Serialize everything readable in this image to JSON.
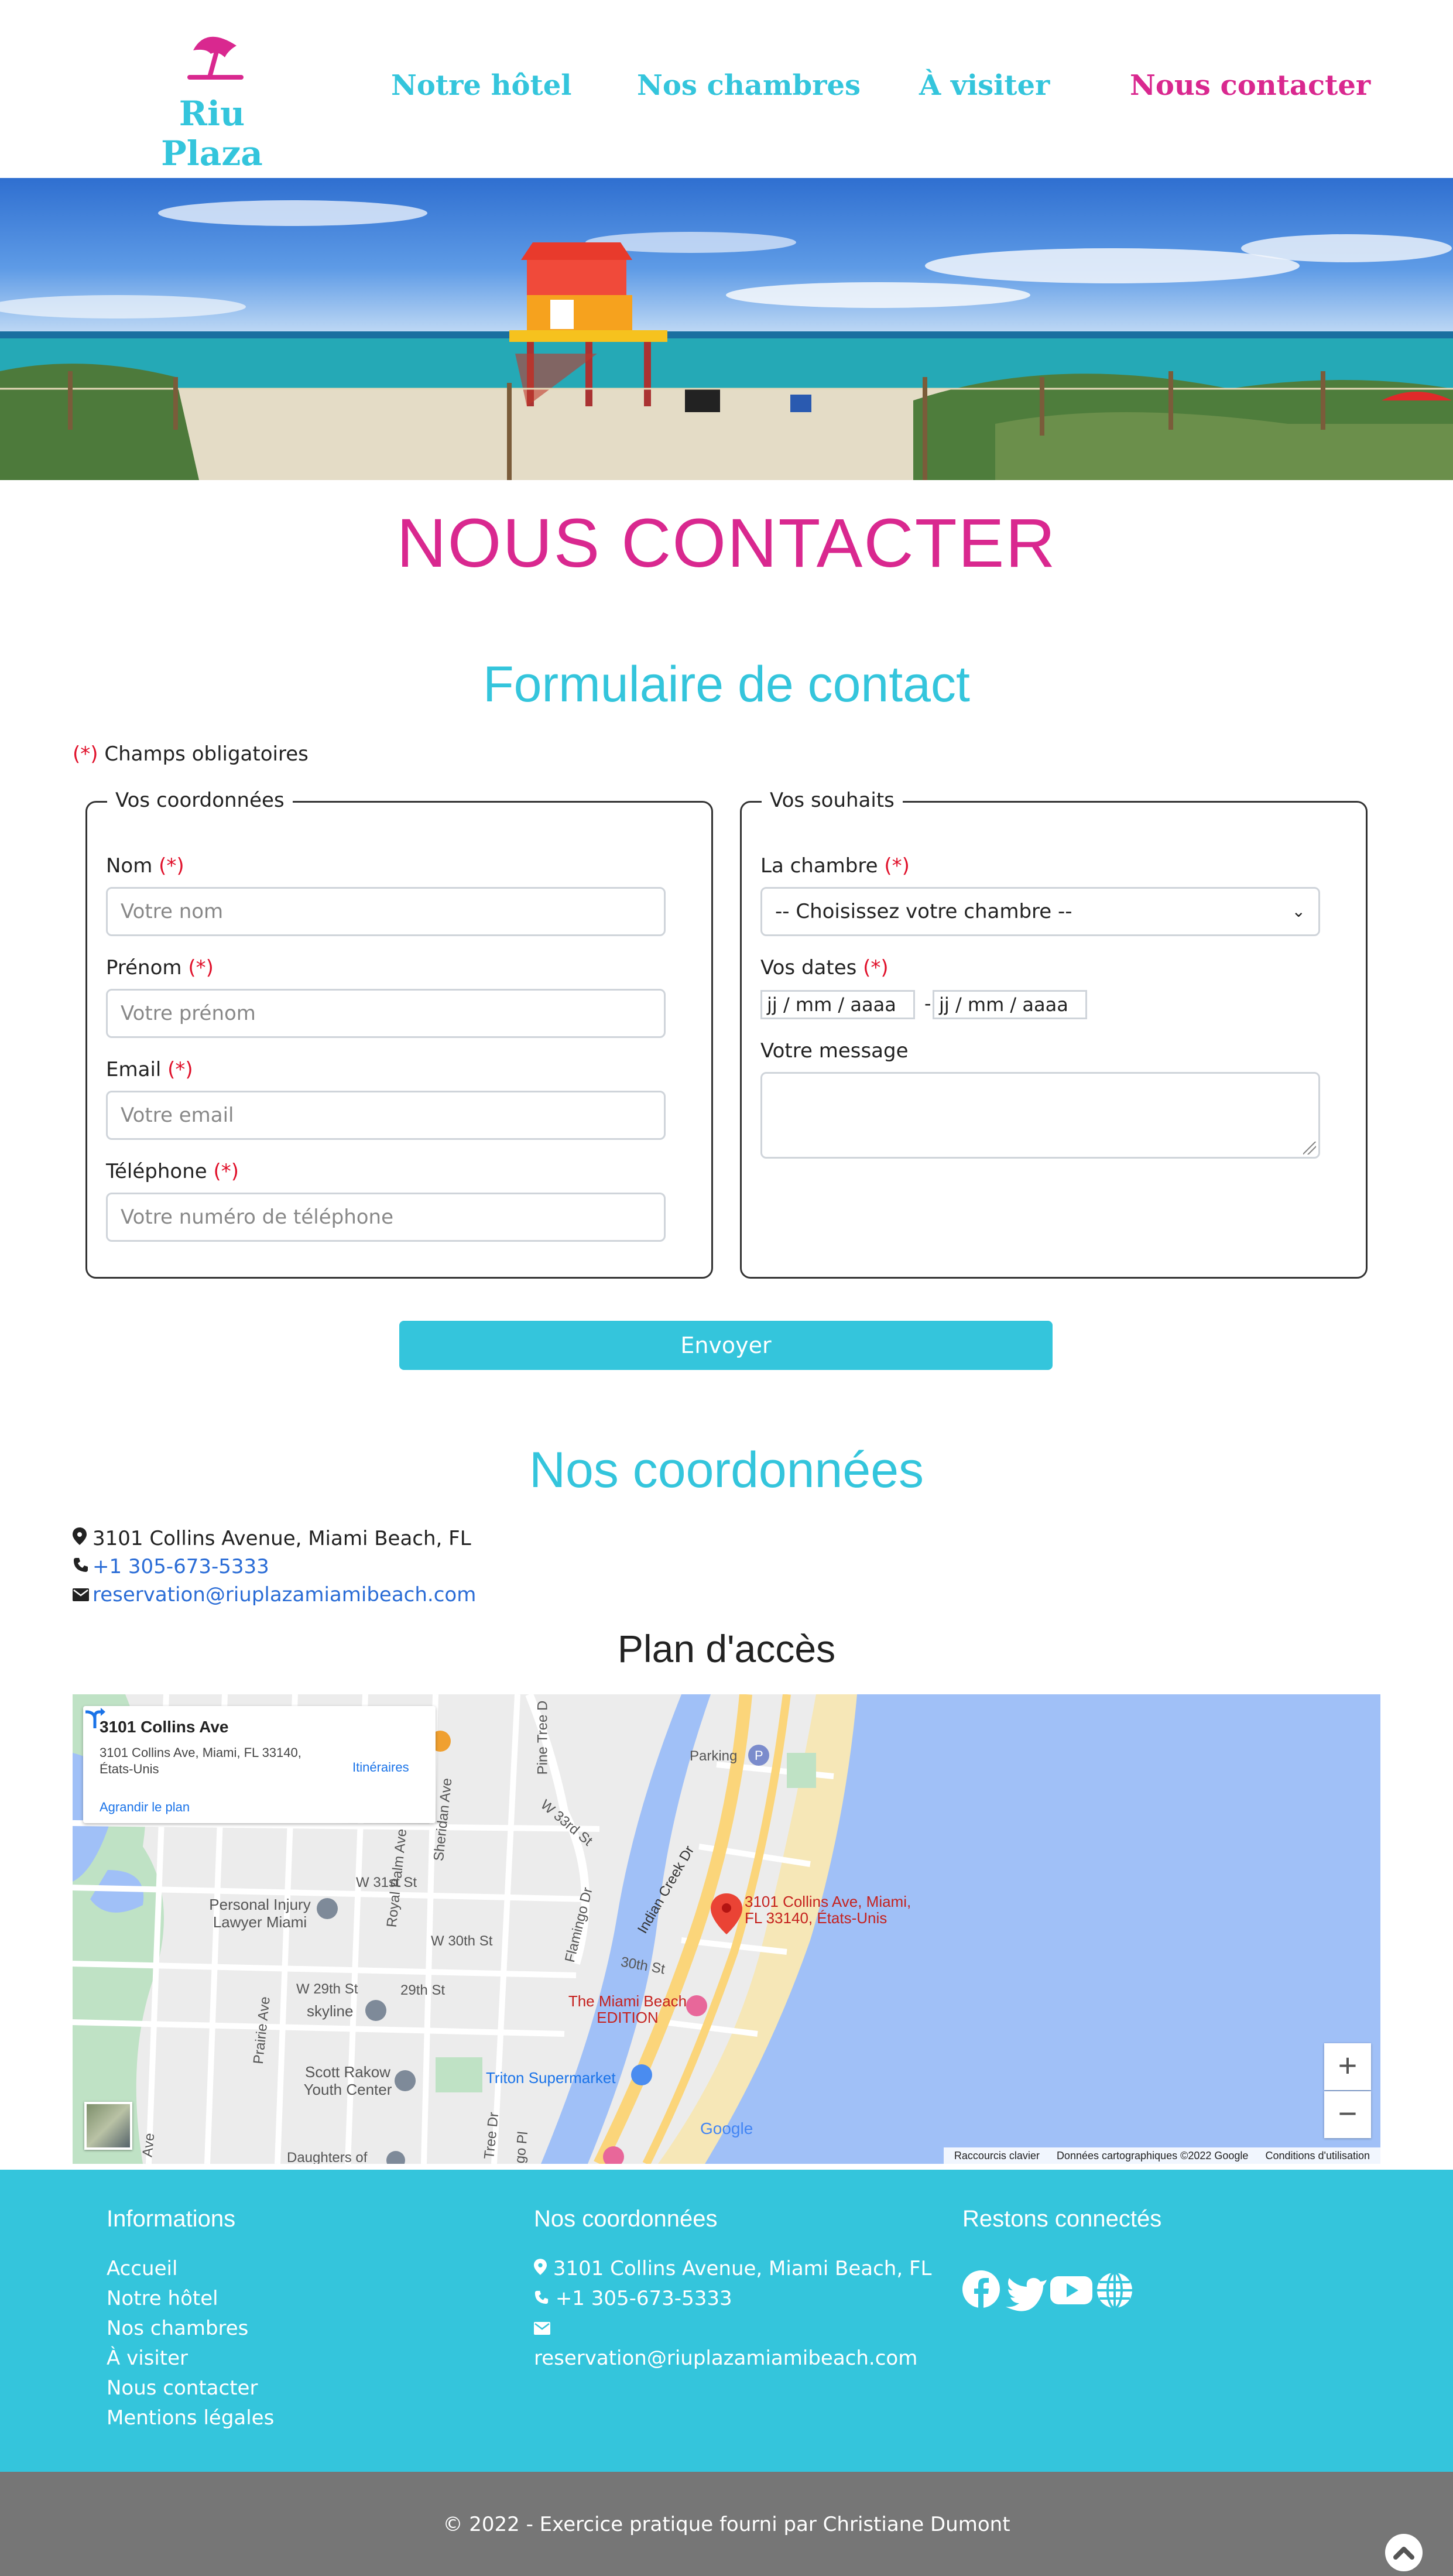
{
  "brand": {
    "name": "Riu Plaza",
    "pink": "#d9288f",
    "turquoise": "#34c5dc"
  },
  "nav": {
    "items": [
      {
        "label": "Notre hôtel"
      },
      {
        "label": "Nos chambres"
      },
      {
        "label": "À visiter"
      },
      {
        "label": "Nous contacter",
        "active": true
      }
    ]
  },
  "hero": {
    "icon": "beach-lifeguard-photo"
  },
  "page_title": "NOUS CONTACTER",
  "form": {
    "title": "Formulaire de contact",
    "required_mark": "(*)",
    "required_note": "Champs obligatoires",
    "coords": {
      "legend": "Vos coordonnées",
      "fields": [
        {
          "label": "Nom",
          "placeholder": "Votre nom"
        },
        {
          "label": "Prénom",
          "placeholder": "Votre prénom"
        },
        {
          "label": "Email",
          "placeholder": "Votre email"
        },
        {
          "label": "Téléphone",
          "placeholder": "Votre numéro de téléphone"
        }
      ]
    },
    "wishes": {
      "legend": "Vos souhaits",
      "room_label": "La chambre",
      "room_selected": "-- Choisissez votre chambre --",
      "dates_label": "Vos dates",
      "date_placeholder": "jj / mm / aaaa",
      "date_separator": "-",
      "message_label": "Votre message"
    },
    "submit": "Envoyer"
  },
  "coordinates": {
    "title": "Nos coordonnées",
    "address": "3101 Collins Avenue, Miami Beach, FL",
    "phone": "+1 305-673-5333",
    "email": "reservation@riuplazamiamibeach.com"
  },
  "plan": {
    "title": "Plan d'accès",
    "card": {
      "title": "3101 Collins Ave",
      "address": "3101 Collins Ave, Miami, FL 33140, États-Unis",
      "directions": "Itinéraires",
      "enlarge": "Agrandir le plan"
    },
    "labels": {
      "marker": "3101 Collins Ave, Miami, FL 33140, États-Unis",
      "parking": "Parking",
      "personal_injury": "Personal Injury Lawyer Miami",
      "skyline": "skyline",
      "scott": "Scott Rakow Youth Center",
      "triton": "Triton Supermarket",
      "edition": "The Miami Beach EDITION",
      "daughters": "Daughters of",
      "indian_creek": "Indian Creek Dr",
      "w33": "W 33rd St",
      "w31": "W 31st St",
      "w30": "W 30th St",
      "w29": "W 29th St",
      "s29": "29th St",
      "s30": "30th St",
      "pine_tree": "Pine Tree D",
      "flamingo": "Flamingo Dr",
      "royal_palm": "Royal Palm Ave",
      "sheridan": "Sheridan Ave",
      "prairie": "Prairie Ave",
      "tree_dr": "Tree Dr",
      "go_pl": "go Pl",
      "ave": "Ave"
    },
    "google": "Google",
    "footer": [
      "Raccourcis clavier",
      "Données cartographiques ©2022 Google",
      "Conditions d'utilisation"
    ]
  },
  "footer": {
    "info_title": "Informations",
    "links": [
      "Accueil",
      "Notre hôtel",
      "Nos chambres",
      "À visiter",
      "Nous contacter",
      "Mentions légales"
    ],
    "coords_title": "Nos coordonnées",
    "address": "3101 Collins Avenue, Miami Beach, FL",
    "phone": "+1 305-673-5333",
    "email": "reservation@riuplazamiamibeach.com",
    "social_title": "Restons connectés",
    "socials": [
      "facebook-icon",
      "twitter-icon",
      "youtube-icon",
      "globe-icon"
    ],
    "copyright": "© 2022 - Exercice pratique fourni par Christiane Dumont"
  }
}
